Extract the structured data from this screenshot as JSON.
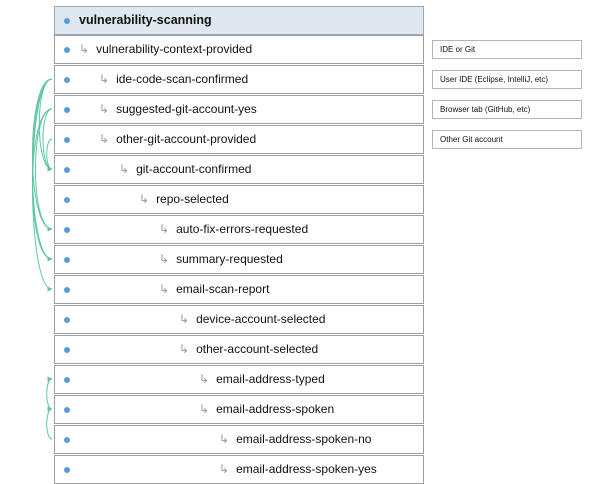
{
  "root": {
    "label": "vulnerability-scanning"
  },
  "steps": [
    {
      "label": "vulnerability-context-provided",
      "depth": 0
    },
    {
      "label": "ide-code-scan-confirmed",
      "depth": 1
    },
    {
      "label": "suggested-git-account-yes",
      "depth": 1
    },
    {
      "label": "other-git-account-provided",
      "depth": 1
    },
    {
      "label": "git-account-confirmed",
      "depth": 2
    },
    {
      "label": "repo-selected",
      "depth": 3
    },
    {
      "label": "auto-fix-errors-requested",
      "depth": 4
    },
    {
      "label": "summary-requested",
      "depth": 4
    },
    {
      "label": "email-scan-report",
      "depth": 4
    },
    {
      "label": "device-account-selected",
      "depth": 5
    },
    {
      "label": "other-account-selected",
      "depth": 5
    },
    {
      "label": "email-address-typed",
      "depth": 6
    },
    {
      "label": "email-address-spoken",
      "depth": 6
    },
    {
      "label": "email-address-spoken-no",
      "depth": 7
    },
    {
      "label": "email-address-spoken-yes",
      "depth": 7
    }
  ],
  "notes": [
    {
      "text": "IDE or Git",
      "row": 0
    },
    {
      "text": "User IDE (Eclipse, IntelliJ, etc)",
      "row": 1
    },
    {
      "text": "Browser tab (GitHub, etc)",
      "row": 2
    },
    {
      "text": "Other Git account",
      "row": 3
    }
  ],
  "links": [
    {
      "from": 1,
      "to": 4
    },
    {
      "from": 1,
      "to": 6
    },
    {
      "from": 1,
      "to": 7
    },
    {
      "from": 1,
      "to": 8
    },
    {
      "from": 2,
      "to": 4
    },
    {
      "from": 2,
      "to": 6
    },
    {
      "from": 2,
      "to": 7
    },
    {
      "from": 3,
      "to": 4
    },
    {
      "from": 12,
      "to": 11
    },
    {
      "from": 13,
      "to": 12
    }
  ],
  "colors": {
    "link": "#5cc6a5",
    "bullet": "#5b9bd5",
    "header_fill": "#dfe7f1"
  },
  "glyph": "↳"
}
